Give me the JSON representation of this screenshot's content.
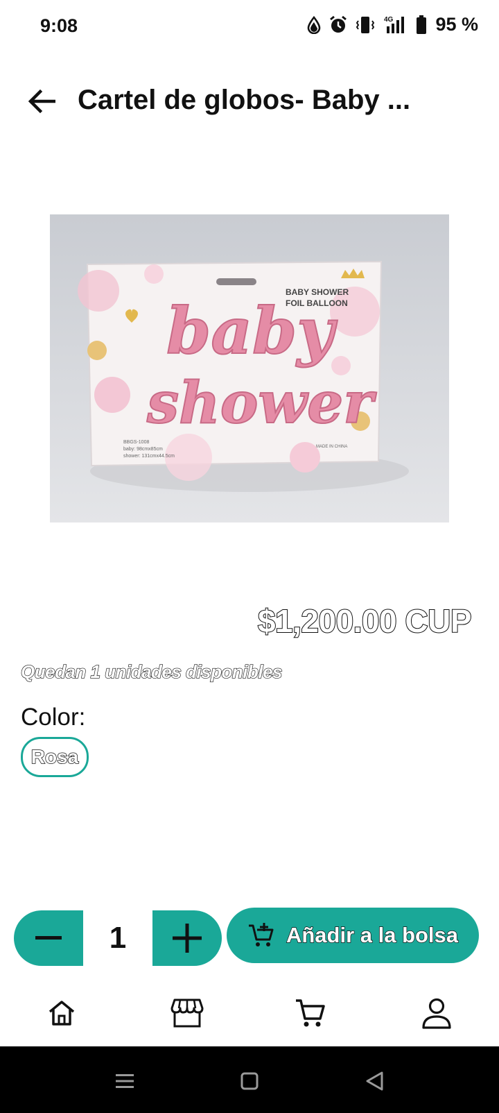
{
  "status_bar": {
    "time": "9:08",
    "network": "4G",
    "battery": "95 %"
  },
  "app_bar": {
    "title": "Cartel de globos- Baby ..."
  },
  "product": {
    "image": {
      "header_line1": "BABY SHOWER",
      "header_line2": "FOIL BALLOON",
      "word1": "baby",
      "word2": "shower",
      "sku": "BBGS-1008",
      "size1": "baby: 98cmx85cm",
      "size2": "shower: 131cmx44.5cm",
      "made_in": "MADE IN CHINA"
    },
    "price": "$1,200.00 CUP",
    "stock_text": "Quedan 1 unidades disponibles",
    "color_label": "Color:",
    "color_options": [
      {
        "label": "Rosa",
        "selected": true
      }
    ]
  },
  "quantity": {
    "value": "1"
  },
  "actions": {
    "add_to_bag": "Añadir a la bolsa"
  },
  "bottom_nav": {
    "items": [
      {
        "name": "home",
        "icon": "home-icon"
      },
      {
        "name": "store",
        "icon": "store-icon"
      },
      {
        "name": "cart",
        "icon": "cart-icon"
      },
      {
        "name": "profile",
        "icon": "person-icon"
      }
    ]
  },
  "colors": {
    "accent": "#1aa898",
    "text": "#111111",
    "system_nav_bg": "#000000"
  }
}
